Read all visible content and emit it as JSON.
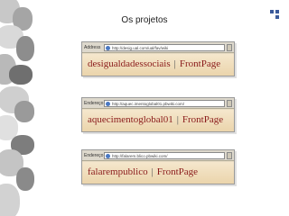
{
  "slide": {
    "title": "Os projetos"
  },
  "cards": [
    {
      "address_label": "Address",
      "url": "http://desig.ual.com/ual/fav/wiki",
      "site_name": "desigualdadessociais",
      "separator": "|",
      "front_page": "FrontPage"
    },
    {
      "address_label": "Endereço",
      "url": "http://aquec.imentoglobal01.pbwiki.com/",
      "site_name": "aquecimentoglobal01",
      "separator": "|",
      "front_page": "FrontPage"
    },
    {
      "address_label": "Endereço",
      "url": "http://falarem.blico.pbwiki.com/",
      "site_name": "falarempublico",
      "separator": "|",
      "front_page": "FrontPage"
    }
  ],
  "colors": {
    "accent": "#3b5a9a",
    "title_red": "#8a1a1a",
    "page_bg": "#f0dfbd"
  }
}
